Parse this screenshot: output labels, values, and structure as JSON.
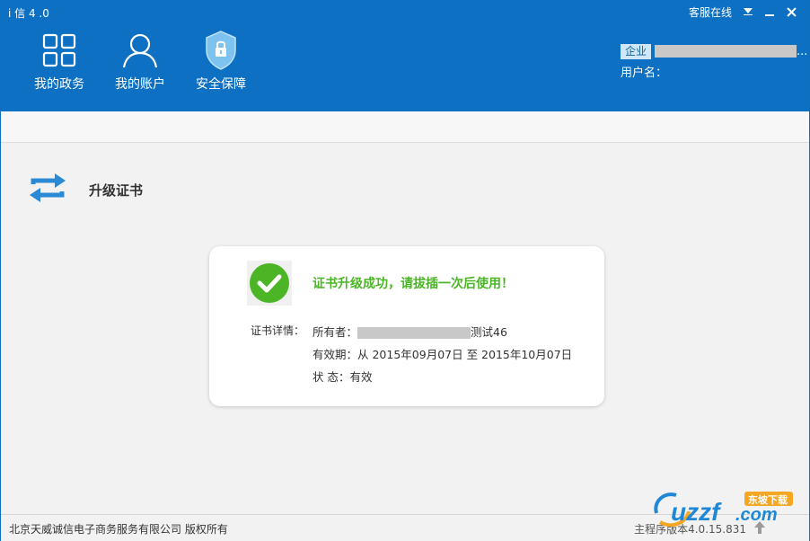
{
  "app": {
    "title": "i 信 4 .0",
    "service_link": "客服在线",
    "colors": {
      "header_blue": "#0d70c2",
      "success_green": "#4bb526"
    }
  },
  "nav": {
    "items": [
      {
        "label": "我的政务",
        "icon": "grid-icon"
      },
      {
        "label": "我的账户",
        "icon": "user-icon"
      },
      {
        "label": "安全保障",
        "icon": "shield-icon"
      }
    ]
  },
  "user": {
    "badge": "企业",
    "name_suffix": "...",
    "username_label": "用户名："
  },
  "section": {
    "title": "升级证书",
    "icon": "swap-arrows-icon"
  },
  "result": {
    "message": "证书升级成功，请拔插一次后使用！",
    "details_label": "证书详情：",
    "owner_label": "所有者：",
    "owner_suffix": "测试46",
    "validity": "有效期：从 2015年09月07日 至 2015年10月07日",
    "status": "状 态：有效"
  },
  "footer": {
    "copyright": "北京天威诚信电子商务服务有限公司 版权所有",
    "version": "主程序版本4.0.15.831"
  },
  "watermark": {
    "text": "uzzf.com",
    "tag": "东坡下载"
  }
}
